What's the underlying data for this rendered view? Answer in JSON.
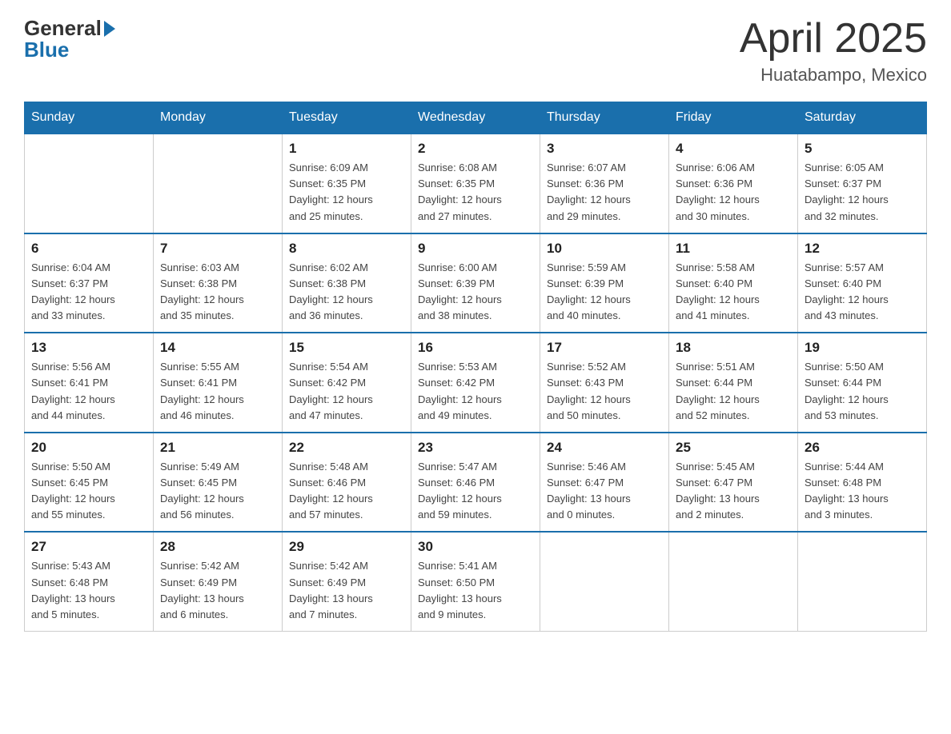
{
  "logo": {
    "text_general": "General",
    "text_blue": "Blue"
  },
  "title": "April 2025",
  "subtitle": "Huatabampo, Mexico",
  "days_of_week": [
    "Sunday",
    "Monday",
    "Tuesday",
    "Wednesday",
    "Thursday",
    "Friday",
    "Saturday"
  ],
  "weeks": [
    [
      {
        "day": "",
        "info": ""
      },
      {
        "day": "",
        "info": ""
      },
      {
        "day": "1",
        "info": "Sunrise: 6:09 AM\nSunset: 6:35 PM\nDaylight: 12 hours\nand 25 minutes."
      },
      {
        "day": "2",
        "info": "Sunrise: 6:08 AM\nSunset: 6:35 PM\nDaylight: 12 hours\nand 27 minutes."
      },
      {
        "day": "3",
        "info": "Sunrise: 6:07 AM\nSunset: 6:36 PM\nDaylight: 12 hours\nand 29 minutes."
      },
      {
        "day": "4",
        "info": "Sunrise: 6:06 AM\nSunset: 6:36 PM\nDaylight: 12 hours\nand 30 minutes."
      },
      {
        "day": "5",
        "info": "Sunrise: 6:05 AM\nSunset: 6:37 PM\nDaylight: 12 hours\nand 32 minutes."
      }
    ],
    [
      {
        "day": "6",
        "info": "Sunrise: 6:04 AM\nSunset: 6:37 PM\nDaylight: 12 hours\nand 33 minutes."
      },
      {
        "day": "7",
        "info": "Sunrise: 6:03 AM\nSunset: 6:38 PM\nDaylight: 12 hours\nand 35 minutes."
      },
      {
        "day": "8",
        "info": "Sunrise: 6:02 AM\nSunset: 6:38 PM\nDaylight: 12 hours\nand 36 minutes."
      },
      {
        "day": "9",
        "info": "Sunrise: 6:00 AM\nSunset: 6:39 PM\nDaylight: 12 hours\nand 38 minutes."
      },
      {
        "day": "10",
        "info": "Sunrise: 5:59 AM\nSunset: 6:39 PM\nDaylight: 12 hours\nand 40 minutes."
      },
      {
        "day": "11",
        "info": "Sunrise: 5:58 AM\nSunset: 6:40 PM\nDaylight: 12 hours\nand 41 minutes."
      },
      {
        "day": "12",
        "info": "Sunrise: 5:57 AM\nSunset: 6:40 PM\nDaylight: 12 hours\nand 43 minutes."
      }
    ],
    [
      {
        "day": "13",
        "info": "Sunrise: 5:56 AM\nSunset: 6:41 PM\nDaylight: 12 hours\nand 44 minutes."
      },
      {
        "day": "14",
        "info": "Sunrise: 5:55 AM\nSunset: 6:41 PM\nDaylight: 12 hours\nand 46 minutes."
      },
      {
        "day": "15",
        "info": "Sunrise: 5:54 AM\nSunset: 6:42 PM\nDaylight: 12 hours\nand 47 minutes."
      },
      {
        "day": "16",
        "info": "Sunrise: 5:53 AM\nSunset: 6:42 PM\nDaylight: 12 hours\nand 49 minutes."
      },
      {
        "day": "17",
        "info": "Sunrise: 5:52 AM\nSunset: 6:43 PM\nDaylight: 12 hours\nand 50 minutes."
      },
      {
        "day": "18",
        "info": "Sunrise: 5:51 AM\nSunset: 6:44 PM\nDaylight: 12 hours\nand 52 minutes."
      },
      {
        "day": "19",
        "info": "Sunrise: 5:50 AM\nSunset: 6:44 PM\nDaylight: 12 hours\nand 53 minutes."
      }
    ],
    [
      {
        "day": "20",
        "info": "Sunrise: 5:50 AM\nSunset: 6:45 PM\nDaylight: 12 hours\nand 55 minutes."
      },
      {
        "day": "21",
        "info": "Sunrise: 5:49 AM\nSunset: 6:45 PM\nDaylight: 12 hours\nand 56 minutes."
      },
      {
        "day": "22",
        "info": "Sunrise: 5:48 AM\nSunset: 6:46 PM\nDaylight: 12 hours\nand 57 minutes."
      },
      {
        "day": "23",
        "info": "Sunrise: 5:47 AM\nSunset: 6:46 PM\nDaylight: 12 hours\nand 59 minutes."
      },
      {
        "day": "24",
        "info": "Sunrise: 5:46 AM\nSunset: 6:47 PM\nDaylight: 13 hours\nand 0 minutes."
      },
      {
        "day": "25",
        "info": "Sunrise: 5:45 AM\nSunset: 6:47 PM\nDaylight: 13 hours\nand 2 minutes."
      },
      {
        "day": "26",
        "info": "Sunrise: 5:44 AM\nSunset: 6:48 PM\nDaylight: 13 hours\nand 3 minutes."
      }
    ],
    [
      {
        "day": "27",
        "info": "Sunrise: 5:43 AM\nSunset: 6:48 PM\nDaylight: 13 hours\nand 5 minutes."
      },
      {
        "day": "28",
        "info": "Sunrise: 5:42 AM\nSunset: 6:49 PM\nDaylight: 13 hours\nand 6 minutes."
      },
      {
        "day": "29",
        "info": "Sunrise: 5:42 AM\nSunset: 6:49 PM\nDaylight: 13 hours\nand 7 minutes."
      },
      {
        "day": "30",
        "info": "Sunrise: 5:41 AM\nSunset: 6:50 PM\nDaylight: 13 hours\nand 9 minutes."
      },
      {
        "day": "",
        "info": ""
      },
      {
        "day": "",
        "info": ""
      },
      {
        "day": "",
        "info": ""
      }
    ]
  ]
}
